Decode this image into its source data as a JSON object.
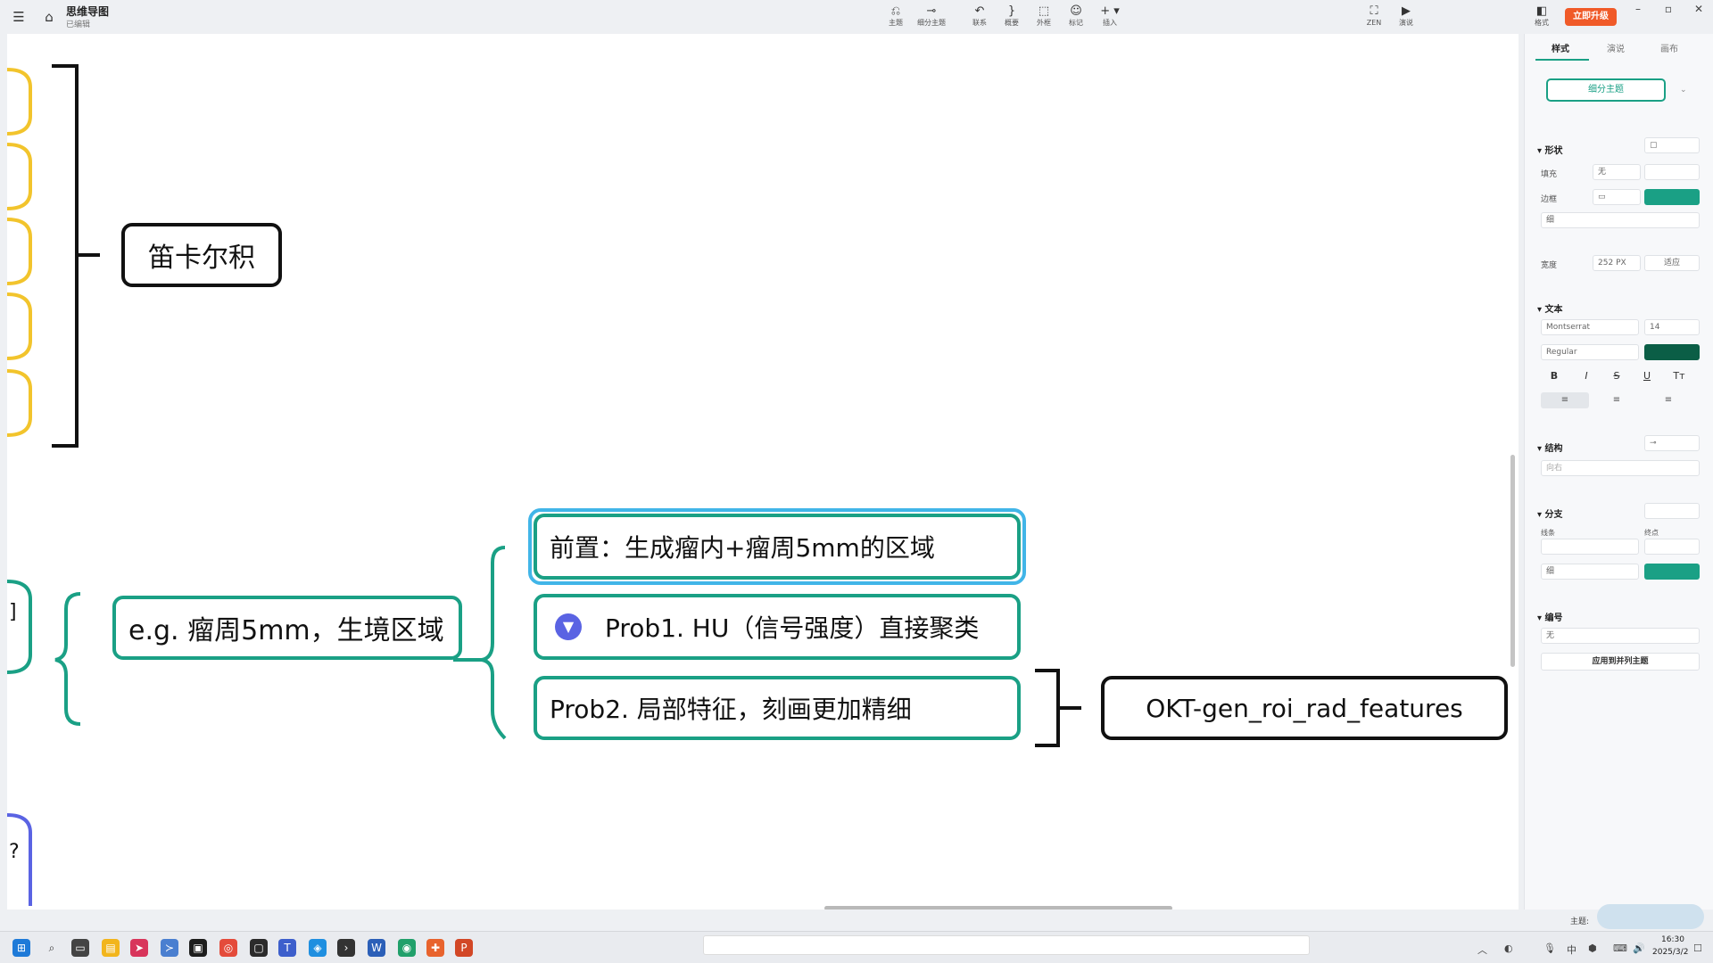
{
  "app": {
    "title": "思维导图",
    "subtitle": "已编辑"
  },
  "toolbar": {
    "items": [
      {
        "label": "主题",
        "icon": "topic-icon"
      },
      {
        "label": "细分主题",
        "icon": "subtopic-icon"
      },
      {
        "label": "联系",
        "icon": "relation-icon"
      },
      {
        "label": "概要",
        "icon": "summary-icon"
      },
      {
        "label": "外框",
        "icon": "boundary-icon"
      },
      {
        "label": "标记",
        "icon": "marker-icon"
      },
      {
        "label": "插入",
        "icon": "insert-icon"
      }
    ],
    "right_items": [
      {
        "label": "ZEN",
        "icon": "zen-icon"
      },
      {
        "label": "演说",
        "icon": "pitch-icon"
      }
    ],
    "panel_toggle_label": "格式",
    "upgrade_label": "立即升级"
  },
  "mindmap": {
    "nodes": {
      "cartesian": "笛卡尔积",
      "eg": "e.g. 瘤周5mm，生境区域",
      "pre": "前置：生成瘤内+瘤周5mm的区域",
      "prob1": "Prob1. HU（信号强度）直接聚类",
      "prob2": "Prob2. 局部特征，刻画更加精细",
      "okt": "OKT-gen_roi_rad_features"
    },
    "colors": {
      "black_border": "#111111",
      "teal_border": "#1aa085",
      "selection": "#41b5e8",
      "yellow_edge": "#f2c42c",
      "blue_edge": "#5a63e3"
    }
  },
  "panel": {
    "tabs": [
      "样式",
      "演说",
      "画布"
    ],
    "topic_style": "细分主题",
    "shape": {
      "title": "形状",
      "fill_label": "填充",
      "fill_value": "无",
      "border_label": "边框",
      "border_weight": "细",
      "border_color": "#1aa085",
      "width_label": "宽度",
      "width_value": "252",
      "width_unit": "PX",
      "fit_label": "适应"
    },
    "text": {
      "title": "文本",
      "font": "Montserrat",
      "size": "14",
      "weight": "Regular",
      "color": "#0b5e46",
      "format_buttons": [
        "B",
        "I",
        "S",
        "U",
        "Tт"
      ],
      "align_buttons": [
        "≡",
        "≡",
        "≡"
      ]
    },
    "structure": {
      "title": "结构",
      "value": "向右"
    },
    "branch": {
      "title": "分支",
      "line_label": "线条",
      "end_label": "终点",
      "weight": "细",
      "color": "#1aa085"
    },
    "numbering": {
      "title": "编号",
      "value": "无"
    },
    "apply_button": "应用到并列主题"
  },
  "status": {
    "topic_label": "主题:"
  },
  "taskbar": {
    "time": "16:30",
    "date": "2025/3/2"
  }
}
